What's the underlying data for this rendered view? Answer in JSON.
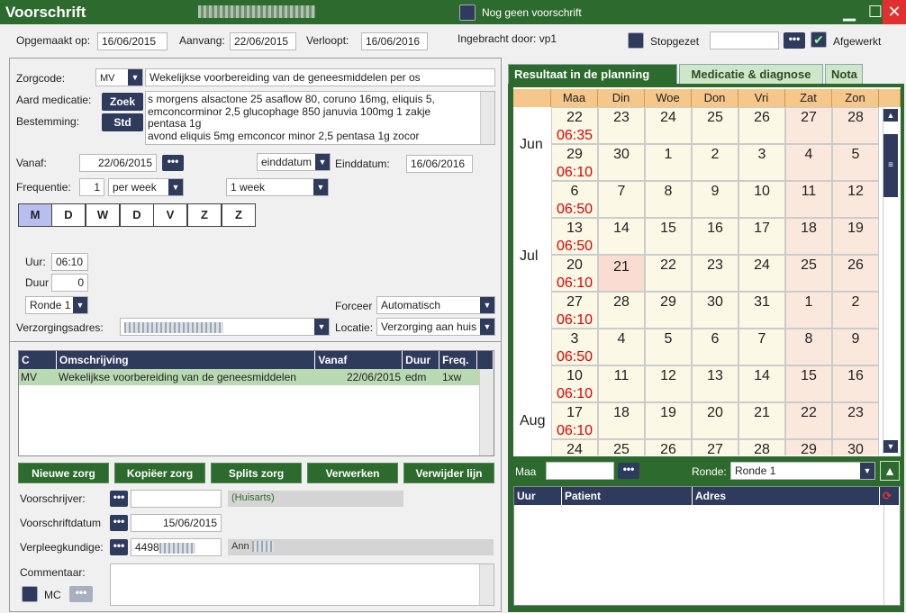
{
  "window": {
    "title": "Voorschrift",
    "no_prescription_label": "Nog geen voorschrift"
  },
  "header": {
    "opgemaakt_label": "Opgemaakt op:",
    "opgemaakt_value": "16/06/2015",
    "aanvang_label": "Aanvang:",
    "aanvang_value": "22/06/2015",
    "verloopt_label": "Verloopt:",
    "verloopt_value": "16/06/2016",
    "ingebracht_label": "Ingebracht door: vp1",
    "stopgezet_label": "Stopgezet",
    "afgewerkt_label": "Afgewerkt"
  },
  "form": {
    "zorgcode_label": "Zorgcode:",
    "zorgcode_value": "MV",
    "zorgcode_desc": "Wekelijkse voorbereiding van de geneesmiddelen per os",
    "aard_label": "Aard medicatie:",
    "zoek_label": "Zoek",
    "bestemming_label": "Bestemming:",
    "std_label": "Std",
    "medication_lines": [
      "s morgens alsactone 25 asaflow 80, coruno 16mg, eliquis 5,",
      "emconcorminor 2,5 glucophage 850 januvia 100mg 1 zakje",
      "pentasa 1g",
      "avond eliquis 5mg emconcor minor 2,5 pentasa  1g zocor"
    ],
    "vanaf_label": "Vanaf:",
    "vanaf_value": "22/06/2015",
    "einddatum_select": "einddatum",
    "einddatum_label": "Einddatum:",
    "einddatum_value": "16/06/2016",
    "frequentie_label": "Frequentie:",
    "frequentie_value": "1",
    "per_select": "per week",
    "period_select": "1 week",
    "days": [
      "M",
      "D",
      "W",
      "D",
      "V",
      "Z",
      "Z"
    ],
    "uur_label": "Uur:",
    "uur_value": "06:10",
    "duur_label": "Duur",
    "duur_value": "0",
    "ronde_select": "Ronde 1",
    "forceer_label": "Forceer",
    "forceer_value": "Automatisch",
    "adres_label": "Verzorgingsadres:",
    "locatie_label": "Locatie:",
    "locatie_value": "Verzorging aan huis"
  },
  "care_table": {
    "headers": [
      "C",
      "Omschrijving",
      "Vanaf",
      "Duur",
      "Freq."
    ],
    "row": {
      "c": "MV",
      "omschrijving": "Wekelijkse voorbereiding van de geneesmiddelen",
      "vanaf": "22/06/2015",
      "duur": "edm",
      "freq": "1xw"
    }
  },
  "actions": [
    "Nieuwe zorg",
    "Kopiëer zorg",
    "Splits zorg",
    "Verwerken",
    "Verwijder lijn"
  ],
  "footer": {
    "voorschrijver_label": "Voorschrijver:",
    "huisarts": "(Huisarts)",
    "voorschriftdatum_label": "Voorschriftdatum",
    "voorschriftdatum_value": "15/06/2015",
    "verpleeg_label": "Verpleegkundige:",
    "verpleeg_value": "4498",
    "verpleeg_name": "Ann",
    "comment_label": "Commentaar:",
    "mc_label": "MC"
  },
  "tabs": [
    "Resultaat in de planning",
    "Medicatie & diagnose",
    "Nota"
  ],
  "calendar": {
    "weekdays": [
      "Maa",
      "Din",
      "Woe",
      "Don",
      "Vri",
      "Zat",
      "Zon"
    ],
    "months": [
      "Jun",
      "Jul",
      "Aug"
    ],
    "weeks": [
      [
        "22",
        "23",
        "24",
        "25",
        "26",
        "27",
        "28"
      ],
      [
        "29",
        "30",
        "1",
        "2",
        "3",
        "4",
        "5"
      ],
      [
        "6",
        "7",
        "8",
        "9",
        "10",
        "11",
        "12"
      ],
      [
        "13",
        "14",
        "15",
        "16",
        "17",
        "18",
        "19"
      ],
      [
        "20",
        "21",
        "22",
        "23",
        "24",
        "25",
        "26"
      ],
      [
        "27",
        "28",
        "29",
        "30",
        "31",
        "1",
        "2"
      ],
      [
        "3",
        "4",
        "5",
        "6",
        "7",
        "8",
        "9"
      ],
      [
        "10",
        "11",
        "12",
        "13",
        "14",
        "15",
        "16"
      ],
      [
        "17",
        "18",
        "19",
        "20",
        "21",
        "22",
        "23"
      ],
      [
        "24",
        "25",
        "26",
        "27",
        "28",
        "29",
        "30"
      ]
    ],
    "times": [
      "06:35",
      "06:10",
      "06:50",
      "06:50",
      "06:10",
      "06:10",
      "06:50",
      "06:10",
      "06:10",
      ""
    ]
  },
  "planning": {
    "maa_label": "Maa",
    "ronde_label": "Ronde:",
    "ronde_value": "Ronde 1",
    "headers": [
      "Uur",
      "Patient",
      "Adres"
    ]
  }
}
